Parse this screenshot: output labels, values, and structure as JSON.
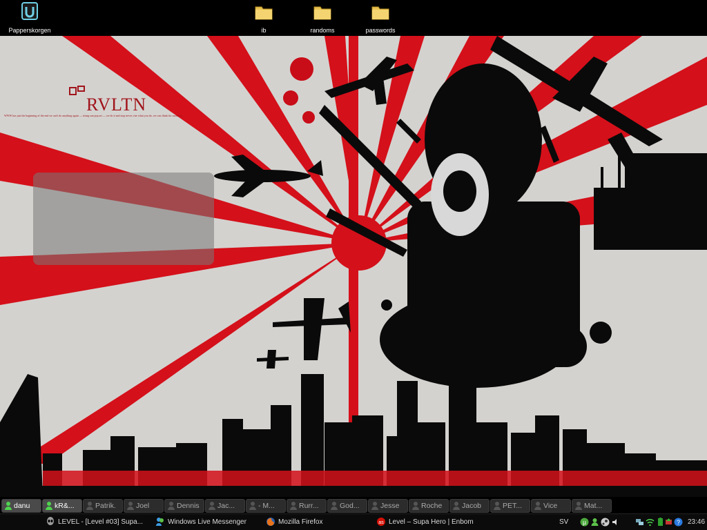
{
  "desktop": {
    "icons": [
      {
        "label": "Papperskorgen",
        "icon": "recycle-bin-icon"
      },
      {
        "label": "ib",
        "icon": "folder-icon"
      },
      {
        "label": "randoms",
        "icon": "folder-icon"
      },
      {
        "label": "passwords",
        "icon": "folder-icon"
      }
    ]
  },
  "wallpaper": {
    "logo": "RVLTN",
    "tagline": "WWW has just the beginning of the end we can't do anything again — rising sun pop art — we do it and stop never; rise what you do, we cast think for ourselves",
    "colors": {
      "red": "#d4101a",
      "paper": "#d4d2cf",
      "ink": "#0a0a0a"
    }
  },
  "contacts": [
    {
      "name": "danu",
      "status": "online"
    },
    {
      "name": "kR&...",
      "status": "online"
    },
    {
      "name": "Patrik.",
      "status": "offline"
    },
    {
      "name": "Joel",
      "status": "offline"
    },
    {
      "name": "Dennis",
      "status": "offline"
    },
    {
      "name": "Jac...",
      "status": "offline"
    },
    {
      "name": "- M...",
      "status": "offline"
    },
    {
      "name": "Rurr...",
      "status": "offline"
    },
    {
      "name": "God...",
      "status": "offline"
    },
    {
      "name": "Jesse",
      "status": "offline"
    },
    {
      "name": "Roche",
      "status": "offline"
    },
    {
      "name": "Jacob",
      "status": "offline"
    },
    {
      "name": "PET...",
      "status": "offline"
    },
    {
      "name": "Vice",
      "status": "offline"
    },
    {
      "name": "Mat...",
      "status": "offline"
    }
  ],
  "taskbar": {
    "tasks": [
      {
        "label": "LEVEL - [Level #03] Supa...",
        "icon": "winamp-alien-icon"
      },
      {
        "label": "Windows Live Messenger",
        "icon": "messenger-icon"
      },
      {
        "label": "Mozilla Firefox",
        "icon": "firefox-icon"
      },
      {
        "label": "Level – Supa Hero | Enbom",
        "icon": "lastfm-icon"
      }
    ],
    "tray": {
      "language": "SV",
      "clock": "23:46",
      "icons": [
        "utorrent-icon",
        "messenger-tray-icon",
        "steam-icon",
        "speaker-icon",
        "network-icon",
        "wifi-icon",
        "battery-icon",
        "safe-remove-icon",
        "help-icon"
      ]
    }
  }
}
